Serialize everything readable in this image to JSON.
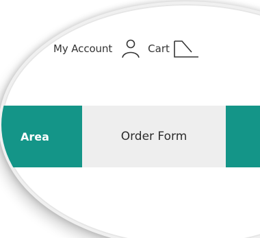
{
  "header": {
    "my_account_label": "My Account",
    "cart_label": "Cart",
    "icons": {
      "account": "user-icon",
      "cart": "cart-icon"
    }
  },
  "nav": {
    "items": [
      {
        "label": "Area",
        "state": "accent"
      },
      {
        "label": "Order Form",
        "state": "active"
      },
      {
        "label": "",
        "state": "accent"
      }
    ]
  },
  "colors": {
    "accent": "#149588",
    "active_tab_bg": "#eeeeee",
    "text": "#333333"
  }
}
